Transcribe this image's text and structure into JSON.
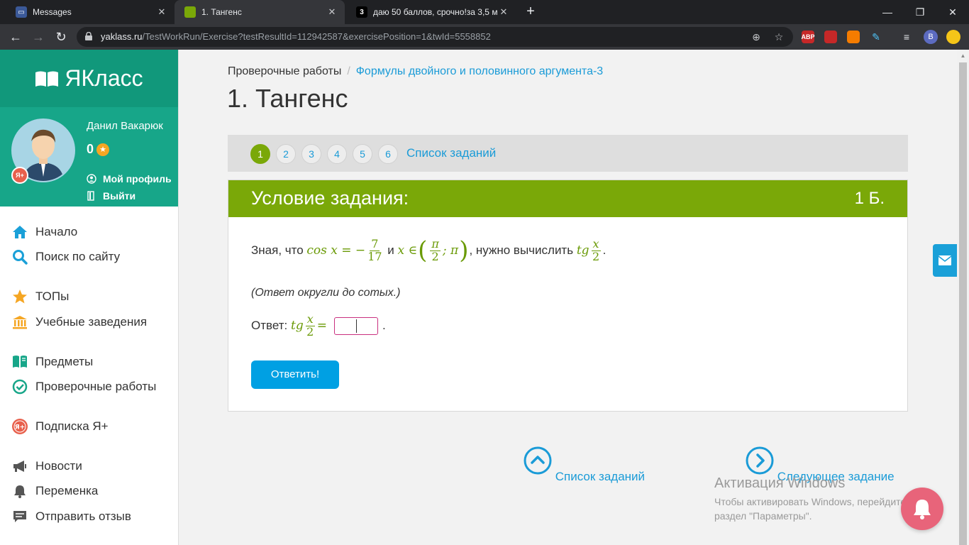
{
  "browser": {
    "tabs": [
      {
        "title": "Messages",
        "favicon": "messages-icon"
      },
      {
        "title": "1. Тангенс",
        "favicon": "yaklass-icon"
      },
      {
        "title": "даю 50 баллов, срочно!за 3,5 м",
        "favicon": "znanija-icon",
        "favicon_text": "3"
      }
    ],
    "url_domain": "yaklass.ru",
    "url_path": "/TestWorkRun/Exercise?testResultId=112942587&exercisePosition=1&twId=5558852",
    "extensions": [
      {
        "name": "abp-extension-icon",
        "badge": "1",
        "color": "#c62828",
        "label": "ABP"
      },
      {
        "name": "extension-red-icon",
        "badge": "2",
        "color": "#c62828",
        "label": ""
      },
      {
        "name": "extension-orange-icon",
        "badge": "",
        "color": "#f57c00",
        "label": ""
      },
      {
        "name": "extension-pen-icon",
        "badge": "",
        "color": "#35363a",
        "label": ""
      }
    ],
    "profile_letter": "B"
  },
  "sidebar": {
    "logo_text": "ЯКласс",
    "user": {
      "name": "Данил Вакарюк",
      "score": "0",
      "profile_link": "Мой профиль",
      "logout_link": "Выйти",
      "badge": "Я+"
    },
    "menu": [
      {
        "label": "Начало",
        "icon": "home-icon",
        "color": "#1aa0d8"
      },
      {
        "label": "Поиск по сайту",
        "icon": "search-icon",
        "color": "#1aa0d8"
      },
      {
        "label": "ТОПы",
        "icon": "star-icon",
        "color": "#f5a623"
      },
      {
        "label": "Учебные заведения",
        "icon": "institution-icon",
        "color": "#f5a623"
      },
      {
        "label": "Предметы",
        "icon": "subjects-icon",
        "color": "#17a689"
      },
      {
        "label": "Проверочные работы",
        "icon": "check-circle-icon",
        "color": "#17a689"
      },
      {
        "label": "Подписка Я+",
        "icon": "subscription-icon",
        "color": "#e8604c"
      },
      {
        "label": "Новости",
        "icon": "megaphone-icon",
        "color": "#555555"
      },
      {
        "label": "Переменка",
        "icon": "bell-icon",
        "color": "#555555"
      },
      {
        "label": "Отправить отзыв",
        "icon": "feedback-icon",
        "color": "#555555"
      }
    ]
  },
  "main": {
    "breadcrumb": {
      "root": "Проверочные работы",
      "separator": "/",
      "current": "Формулы двойного и половинного аргумента-3"
    },
    "title": "1. Тангенс",
    "pager": {
      "pages": [
        "1",
        "2",
        "3",
        "4",
        "5",
        "6"
      ],
      "current": "1",
      "list_link": "Список заданий"
    },
    "task": {
      "header": "Условие задания:",
      "points": "1 Б.",
      "cond_prefix": "Зная, что",
      "cond_cos": "cos x = −",
      "cond_frac_num": "7",
      "cond_frac_den": "17",
      "cond_and": "и",
      "cond_x_in": "x ∈",
      "cond_pi_num": "π",
      "cond_pi_den": "2",
      "cond_pi": "; π",
      "cond_mid": ", нужно вычислить",
      "cond_tg": "tg",
      "cond_x_num": "x",
      "cond_x_den": "2",
      "cond_end": ".",
      "hint": "(Ответ округли до сотых.)",
      "answer_label": "Ответ:",
      "answer_tg": "tg",
      "answer_x_num": "x",
      "answer_x_den": "2",
      "answer_eq": "=",
      "answer_value": "",
      "answer_end": ".",
      "submit_label": "Ответить!"
    },
    "bottom_nav": {
      "list": "Список заданий",
      "next": "Следующее задание"
    }
  },
  "watermark": {
    "line1": "Активация Windows",
    "line2": "Чтобы активировать Windows, перейдите в",
    "line3": "раздел \"Параметры\"."
  },
  "colors": {
    "brand_green": "#7aa808",
    "teal": "#17a689",
    "link_blue": "#1a9bd7",
    "button_blue": "#00a0e3"
  }
}
